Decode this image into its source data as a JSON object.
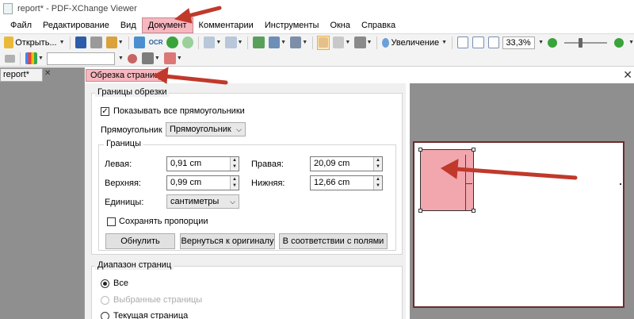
{
  "window": {
    "title": "report* - PDF-XChange Viewer"
  },
  "menu": {
    "items": [
      "Файл",
      "Редактирование",
      "Вид",
      "Документ",
      "Комментарии",
      "Инструменты",
      "Окна",
      "Справка"
    ],
    "active": "Документ"
  },
  "toolbar": {
    "open_label": "Открыть...",
    "zoom_label": "Увеличение",
    "zoom_value": "33,3%",
    "ocr_label": "OCR"
  },
  "doc_tab": {
    "label": "report*"
  },
  "dialog": {
    "title": "Обрезка страниц",
    "crop_group": {
      "legend": "Границы обрезки",
      "show_all_label": "Показывать все прямоугольники",
      "show_all_checked": true,
      "rect_label": "Прямоугольник",
      "rect_value": "Прямоугольник",
      "bounds": {
        "legend": "Границы",
        "left_label": "Левая:",
        "left_value": "0,91 cm",
        "right_label": "Правая:",
        "right_value": "20,09 cm",
        "top_label": "Верхняя:",
        "top_value": "0,99 cm",
        "bottom_label": "Нижняя:",
        "bottom_value": "12,66 cm",
        "units_label": "Единицы:",
        "units_value": "сантиметры",
        "keep_ratio_label": "Сохранять пропорции",
        "keep_ratio_checked": false,
        "reset_label": "Обнулить",
        "revert_label": "Вернуться к оригиналу",
        "fit_margins_label": "В соответствии с полями"
      }
    },
    "range_group": {
      "legend": "Диапазон страниц",
      "all_label": "Все",
      "selected_label": "Выбранные страницы",
      "current_label": "Текущая страница",
      "selected_option": "Все"
    }
  },
  "colors": {
    "highlight": "#f6b7bf",
    "arrow": "#c0392b",
    "preview_frame": "#6d2a2a"
  }
}
